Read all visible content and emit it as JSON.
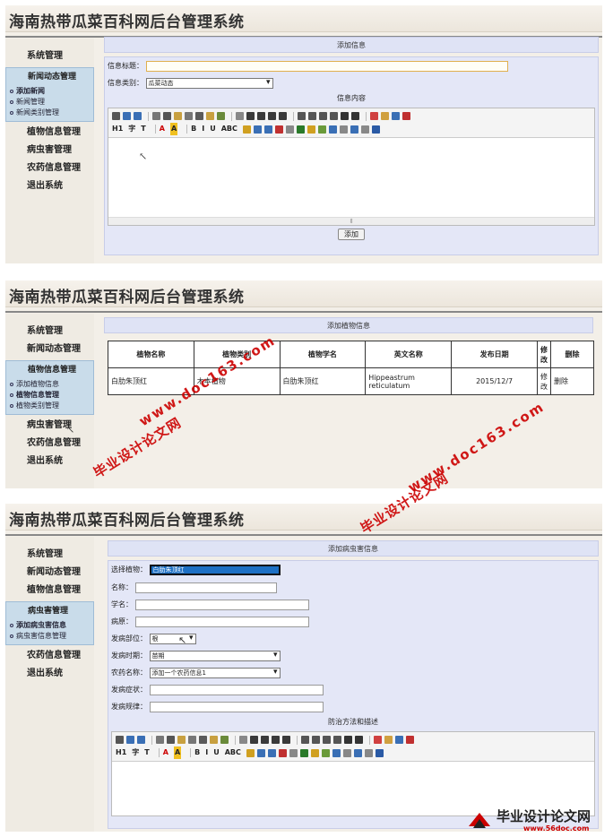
{
  "app_title": "海南热带瓜菜百科网后台管理系统",
  "colors": {
    "accent": "#1c6fc4",
    "watermark": "#cc0000",
    "header_bg": "#dfe3f5",
    "menu_group_bg": "#c9dcea"
  },
  "panel1": {
    "sidebar": {
      "item_system": "系统管理",
      "group_title": "新闻动态管理",
      "subs": [
        "添加新闻",
        "新闻管理",
        "新闻类别管理"
      ],
      "items_after": [
        "植物信息管理",
        "病虫害管理",
        "农药信息管理",
        "退出系统"
      ]
    },
    "header": "添加信息",
    "title_label": "信息标题：",
    "category_label": "信息类别：",
    "category_value": "瓜菜动态",
    "content_label": "信息内容",
    "submit": "添加"
  },
  "panel2": {
    "sidebar": {
      "items_before": [
        "系统管理",
        "新闻动态管理"
      ],
      "group_title": "植物信息管理",
      "subs": [
        "添加植物信息",
        "植物信息管理",
        "植物类别管理"
      ],
      "items_after": [
        "病虫害管理",
        "农药信息管理",
        "退出系统"
      ]
    },
    "header": "添加植物信息",
    "table": {
      "columns": [
        "植物名称",
        "植物类别",
        "植物学名",
        "英文名称",
        "发布日期",
        "修改",
        "删除"
      ],
      "rows": [
        [
          "白肋朱顶红",
          "木本植物",
          "白肋朱顶红",
          "Hippeastrum reticulatum",
          "2015/12/7",
          "修改",
          "删除"
        ]
      ]
    }
  },
  "panel3": {
    "sidebar": {
      "items_before": [
        "系统管理",
        "新闻动态管理",
        "植物信息管理"
      ],
      "group_title": "病虫害管理",
      "subs": [
        "添加病虫害信息",
        "病虫害信息管理"
      ],
      "items_after": [
        "农药信息管理",
        "退出系统"
      ]
    },
    "header": "添加病虫害信息",
    "fields": {
      "plant_label": "选择植物：",
      "plant_value": "白肋朱顶红",
      "name_label": "名称：",
      "sci_label": "学名：",
      "pathogen_label": "病原：",
      "site_label": "发病部位：",
      "site_value": "根",
      "period_label": "发病时期：",
      "period_value": "苗期",
      "pesticide_label": "农药名称：",
      "pesticide_value": "添加一个农药信息1",
      "symptom_label": "发病症状：",
      "pattern_label": "发病规律："
    },
    "content_label": "防治方法和描述"
  },
  "toolbar": {
    "row2": [
      "H1",
      "字",
      "T",
      "A",
      "A",
      "B",
      "I",
      "U",
      "ABC"
    ]
  },
  "watermarks": {
    "url": "www.doc163.com",
    "site_name": "毕业设计论文网",
    "logo_main": "毕业设计论文网",
    "logo_url": "www.56doc.com"
  }
}
